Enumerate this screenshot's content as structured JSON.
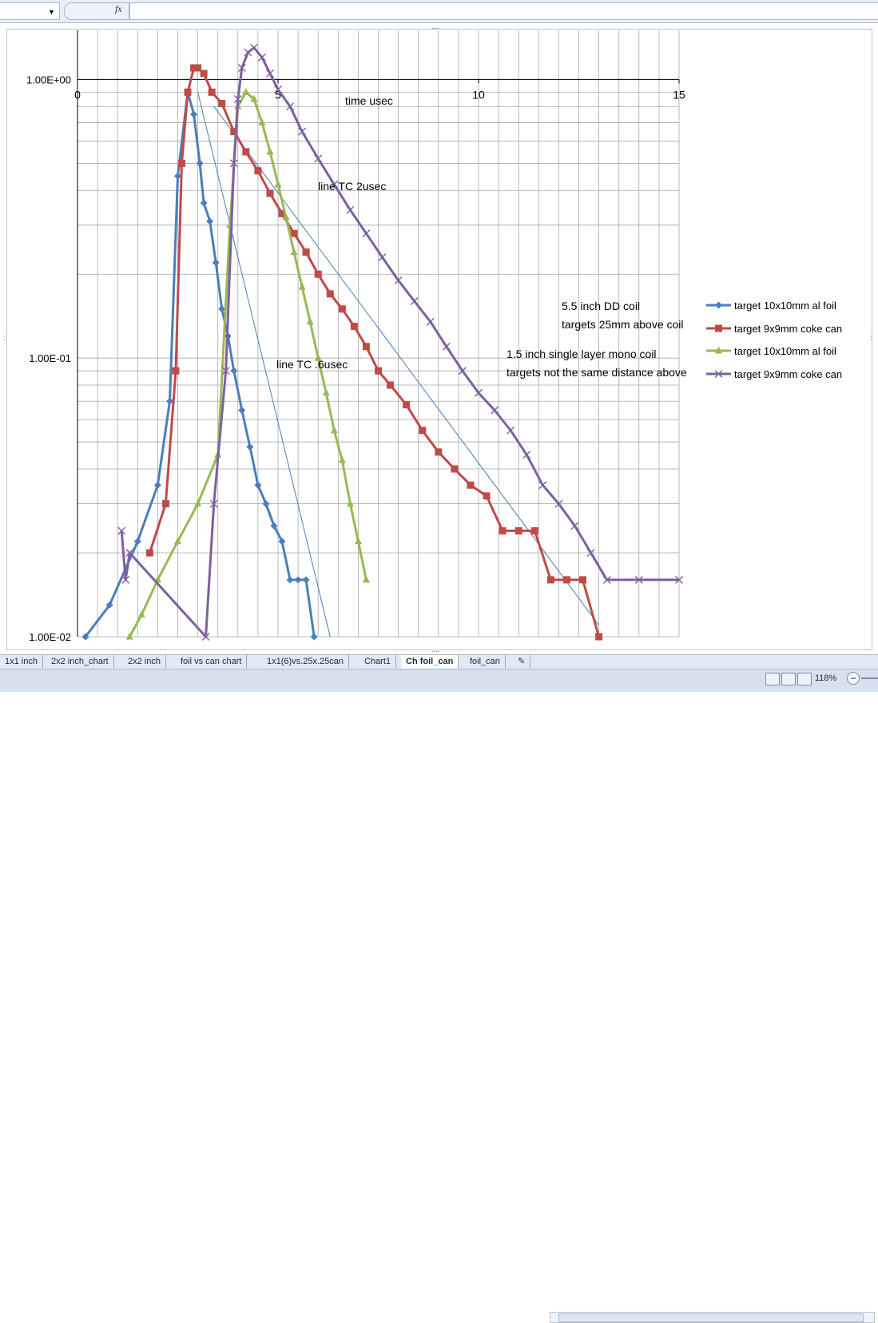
{
  "app": {
    "fx_label": "fx",
    "sheet_tabs": [
      "1x1 inch",
      "2x2 inch_chart",
      "2x2 inch",
      "foil vs can chart",
      "1x1(6)vs.25x.25can",
      "Chart1",
      "Ch foil_can",
      "foil_can"
    ],
    "active_tab": "Ch foil_can",
    "zoom": "118%",
    "colors": {
      "series1": "#4a7ebb",
      "series2": "#be4b48",
      "series3": "#98b954",
      "series4": "#7d60a0",
      "tc_line": "#4a7ebb"
    }
  },
  "chart_data": {
    "type": "scatter",
    "y_scale": "log",
    "xlim": [
      0,
      15
    ],
    "ylim": [
      0.01,
      1.5
    ],
    "x_ticks": [
      "0",
      "5",
      "10",
      "15"
    ],
    "y_ticks": [
      "1.00E+00",
      "1.00E-01",
      "1.00E-02"
    ],
    "grid": true,
    "legend_position": "right",
    "annotations": [
      "time usec",
      "line TC 2usec",
      "line TC .6usec",
      "5.5 inch DD coil",
      "targets 25mm above coil",
      "1.5 inch single layer mono coil",
      "targets not the same distance above"
    ],
    "series": [
      {
        "name": "target 10x10mm al foil",
        "marker": "diamond",
        "color": "#4a7ebb",
        "x": [
          0.2,
          0.8,
          1.5,
          2.0,
          2.3,
          2.5,
          2.75,
          2.9,
          3.05,
          3.15,
          3.3,
          3.45,
          3.6,
          3.75,
          3.9,
          4.1,
          4.3,
          4.5,
          4.7,
          4.9,
          5.1,
          5.3,
          5.5,
          5.7,
          5.9
        ],
        "y": [
          0.01,
          0.013,
          0.022,
          0.035,
          0.07,
          0.45,
          0.9,
          0.75,
          0.5,
          0.36,
          0.31,
          0.22,
          0.15,
          0.12,
          0.09,
          0.065,
          0.048,
          0.035,
          0.03,
          0.025,
          0.022,
          0.016,
          0.016,
          0.016,
          0.01
        ]
      },
      {
        "name": "target 9x9mm coke can",
        "marker": "square",
        "color": "#be4b48",
        "x": [
          1.8,
          2.2,
          2.45,
          2.6,
          2.75,
          2.9,
          3.0,
          3.15,
          3.35,
          3.6,
          3.9,
          4.2,
          4.5,
          4.8,
          5.1,
          5.4,
          5.7,
          6.0,
          6.3,
          6.6,
          6.9,
          7.2,
          7.5,
          7.8,
          8.2,
          8.6,
          9.0,
          9.4,
          9.8,
          10.2,
          10.6,
          11.0,
          11.4,
          11.8,
          12.2,
          12.6,
          13.0
        ],
        "y": [
          0.02,
          0.03,
          0.09,
          0.5,
          0.9,
          1.1,
          1.1,
          1.05,
          0.9,
          0.82,
          0.65,
          0.55,
          0.47,
          0.39,
          0.33,
          0.28,
          0.24,
          0.2,
          0.17,
          0.15,
          0.13,
          0.11,
          0.09,
          0.08,
          0.068,
          0.055,
          0.046,
          0.04,
          0.035,
          0.032,
          0.024,
          0.024,
          0.024,
          0.016,
          0.016,
          0.016,
          0.01
        ]
      },
      {
        "name": "target 10x10mm al foil",
        "marker": "triangle",
        "color": "#98b954",
        "x": [
          1.3,
          1.6,
          2.0,
          2.5,
          3.0,
          3.5,
          3.8,
          4.0,
          4.2,
          4.4,
          4.6,
          4.8,
          5.0,
          5.2,
          5.4,
          5.6,
          5.8,
          6.0,
          6.2,
          6.4,
          6.6,
          6.8,
          7.0,
          7.2
        ],
        "y": [
          0.01,
          0.012,
          0.016,
          0.022,
          0.03,
          0.045,
          0.3,
          0.8,
          0.9,
          0.85,
          0.7,
          0.55,
          0.42,
          0.32,
          0.24,
          0.18,
          0.135,
          0.1,
          0.075,
          0.055,
          0.043,
          0.03,
          0.022,
          0.016
        ]
      },
      {
        "name": "target 9x9mm coke can",
        "marker": "x",
        "color": "#7d60a0",
        "x": [
          1.1,
          1.2,
          1.3,
          3.2,
          3.4,
          3.7,
          3.9,
          4.0,
          4.1,
          4.25,
          4.4,
          4.6,
          4.8,
          5.0,
          5.3,
          5.6,
          6.0,
          6.4,
          6.8,
          7.2,
          7.6,
          8.0,
          8.4,
          8.8,
          9.2,
          9.6,
          10.0,
          10.4,
          10.8,
          11.2,
          11.6,
          12.0,
          12.4,
          12.8,
          13.2,
          14.0,
          15.0
        ],
        "y": [
          0.024,
          0.016,
          0.02,
          0.01,
          0.03,
          0.09,
          0.5,
          0.85,
          1.1,
          1.25,
          1.3,
          1.2,
          1.05,
          0.92,
          0.8,
          0.65,
          0.52,
          0.42,
          0.34,
          0.28,
          0.23,
          0.19,
          0.16,
          0.135,
          0.11,
          0.09,
          0.075,
          0.065,
          0.055,
          0.045,
          0.035,
          0.03,
          0.025,
          0.02,
          0.016,
          0.016,
          0.016
        ]
      }
    ],
    "tc_lines": [
      {
        "label": "line TC 2usec",
        "x": [
          3.4,
          13.0
        ],
        "y": [
          0.8,
          0.011
        ]
      },
      {
        "label": "line TC .6usec",
        "x": [
          3.0,
          6.3
        ],
        "y": [
          0.9,
          0.01
        ]
      }
    ]
  }
}
